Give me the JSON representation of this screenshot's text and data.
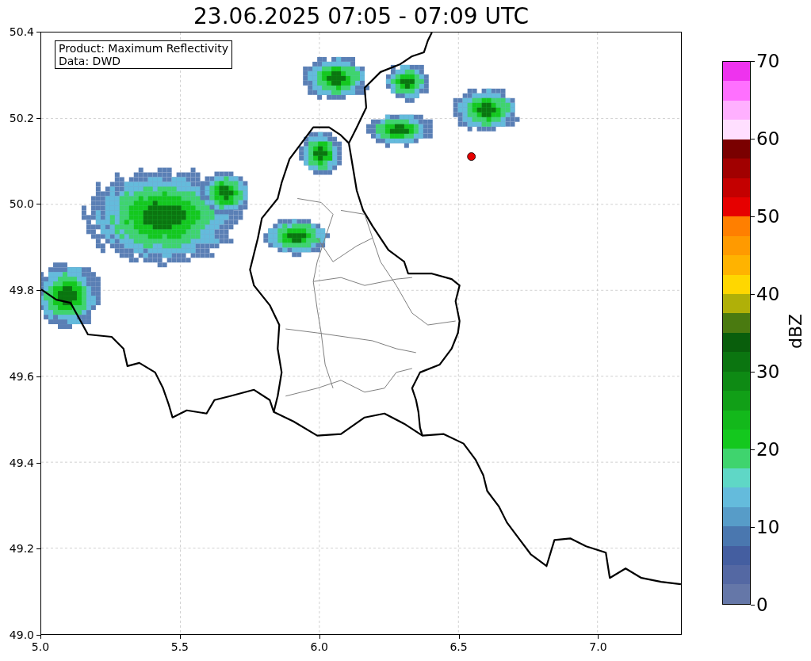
{
  "title": "23.06.2025 07:05 - 07:09 UTC",
  "info_box": [
    "Product: Maximum Reflectivity",
    "Data: DWD"
  ],
  "x_ticks": [
    "5.0",
    "5.5",
    "6.0",
    "6.5",
    "7.0"
  ],
  "y_ticks": [
    "50.4",
    "50.2",
    "50.0",
    "49.8",
    "49.6",
    "49.4",
    "49.2",
    "49.0"
  ],
  "colorbar": {
    "label": "dBZ",
    "ticks": [
      "70",
      "60",
      "50",
      "40",
      "30",
      "20",
      "10",
      "0"
    ],
    "bands": [
      {
        "color": "#6577a8"
      },
      {
        "color": "#5468a3"
      },
      {
        "color": "#445ea0"
      },
      {
        "color": "#4a77af"
      },
      {
        "color": "#579cc8"
      },
      {
        "color": "#64bbdc"
      },
      {
        "color": "#5fd7c6"
      },
      {
        "color": "#3fd46e"
      },
      {
        "color": "#14c81e"
      },
      {
        "color": "#13b81b"
      },
      {
        "color": "#119f17"
      },
      {
        "color": "#0e8a14"
      },
      {
        "color": "#0b7510"
      },
      {
        "color": "#095e0c"
      },
      {
        "color": "#4a7a10"
      },
      {
        "color": "#b0b008"
      },
      {
        "color": "#ffd700"
      },
      {
        "color": "#ffb300"
      },
      {
        "color": "#ff9a00"
      },
      {
        "color": "#ff7f00"
      },
      {
        "color": "#e60000"
      },
      {
        "color": "#c40000"
      },
      {
        "color": "#a10000"
      },
      {
        "color": "#7a0000"
      },
      {
        "color": "#ffdfff"
      },
      {
        "color": "#ffb0ff"
      },
      {
        "color": "#ff70ff"
      },
      {
        "color": "#ee33ee"
      }
    ]
  }
}
